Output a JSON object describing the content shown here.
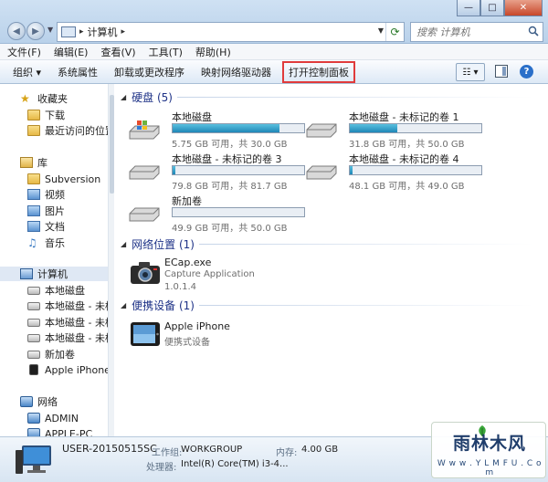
{
  "window": {
    "minimize_glyph": "—",
    "maximize_glyph": "□",
    "close_glyph": "✕"
  },
  "address": {
    "separator": "▸",
    "location": "计算机",
    "search_placeholder": "搜索 计算机"
  },
  "menu": [
    "文件(F)",
    "编辑(E)",
    "查看(V)",
    "工具(T)",
    "帮助(H)"
  ],
  "toolbar": {
    "organize": "组织 ▾",
    "system_properties": "系统属性",
    "uninstall_program": "卸载或更改程序",
    "map_drive": "映射网络驱动器",
    "open_control_panel": "打开控制面板",
    "view_glyph": "☷ ▾",
    "help_glyph": "?"
  },
  "nav": {
    "favorites": "收藏夹",
    "downloads": "下载",
    "recent": "最近访问的位置",
    "libraries": "库",
    "lib_subversion": "Subversion",
    "lib_video": "视频",
    "lib_pictures": "图片",
    "lib_documents": "文档",
    "lib_music": "音乐",
    "computer": "计算机",
    "drive_local": "本地磁盘",
    "drive_unlabeled_1": "本地磁盘 - 未标记",
    "drive_unlabeled_2": "本地磁盘 - 未标记",
    "drive_unlabeled_3": "本地磁盘 - 未标记",
    "new_volume": "新加卷",
    "apple_iphone": "Apple iPhone",
    "network": "网络",
    "net_admin": "ADMIN",
    "net_apple_pc": "APPLE-PC"
  },
  "groups": {
    "drives": "硬盘 (5)",
    "network_locations": "网络位置 (1)",
    "portable_devices": "便携设备 (1)"
  },
  "drives": [
    {
      "name": "本地磁盘",
      "info": "5.75 GB 可用，共 30.0 GB",
      "used_fraction": 0.81
    },
    {
      "name": "本地磁盘 - 未标记的卷 1",
      "info": "31.8 GB 可用，共 50.0 GB",
      "used_fraction": 0.36
    },
    {
      "name": "本地磁盘 - 未标记的卷 3",
      "info": "79.8 GB 可用，共 81.7 GB",
      "used_fraction": 0.02
    },
    {
      "name": "本地磁盘 - 未标记的卷 4",
      "info": "48.1 GB 可用，共 49.0 GB",
      "used_fraction": 0.02
    },
    {
      "name": "新加卷",
      "info": "49.9 GB 可用，共 50.0 GB",
      "used_fraction": 0.0
    }
  ],
  "network_item": {
    "name": "ECap.exe",
    "description": "Capture Application",
    "version": "1.0.1.4"
  },
  "portable_item": {
    "name": "Apple iPhone",
    "type": "便携式设备"
  },
  "details": {
    "computer_name": "USER-20150515SC",
    "workgroup_label": "工作组:",
    "workgroup_value": "WORKGROUP",
    "memory_label": "内存:",
    "memory_value": "4.00 GB",
    "processor_label": "处理器:",
    "processor_value": "Intel(R) Core(TM) i3-4..."
  },
  "watermark": {
    "brand": "雨林木风",
    "url": "W w w . Y L M F U . C o m"
  },
  "colors": {
    "drive_bar": "#1f87b7",
    "highlight_box": "#e03b3b",
    "group_title": "#1e3287"
  }
}
